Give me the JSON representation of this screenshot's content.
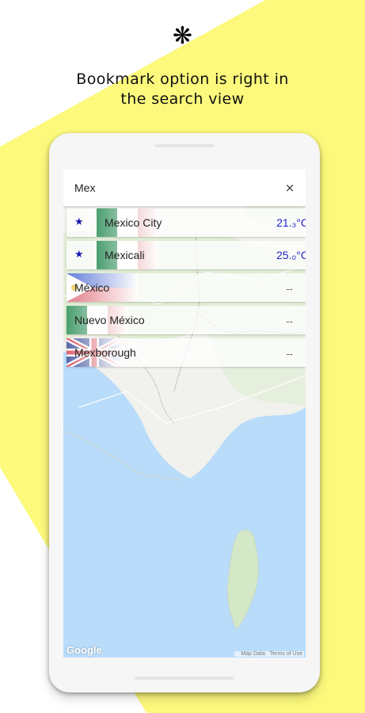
{
  "colors": {
    "accent": "#fcf97c",
    "map_water": "#b9dcfb",
    "star": "#1a1ab0",
    "temperature": "#2222cc"
  },
  "logo": {
    "glyph": "❋",
    "icon": "snowflake-icon"
  },
  "headline": {
    "line1": "Bookmark option is right in",
    "line2": "the search view"
  },
  "search": {
    "value": "Mex",
    "clear_label": "×"
  },
  "results": [
    {
      "name": "Mexico City",
      "bookmarked": true,
      "star": "★",
      "temperature": "21.₃°C",
      "flag": "mexico-flag-icon"
    },
    {
      "name": "Mexicali",
      "bookmarked": true,
      "star": "★",
      "temperature": "25.₀°C",
      "flag": "mexico-flag-icon"
    },
    {
      "name": "México",
      "bookmarked": false,
      "star": "",
      "temperature": "--",
      "flag": "philippines-flag-icon"
    },
    {
      "name": "Nuevo México",
      "bookmarked": false,
      "star": "",
      "temperature": "--",
      "flag": "mexico-flag-icon"
    },
    {
      "name": "Mexborough",
      "bookmarked": false,
      "star": "",
      "temperature": "--",
      "flag": "uk-flag-icon"
    }
  ],
  "map": {
    "brand": "Google",
    "map_data": "Map Data",
    "terms": "Terms of Use"
  }
}
